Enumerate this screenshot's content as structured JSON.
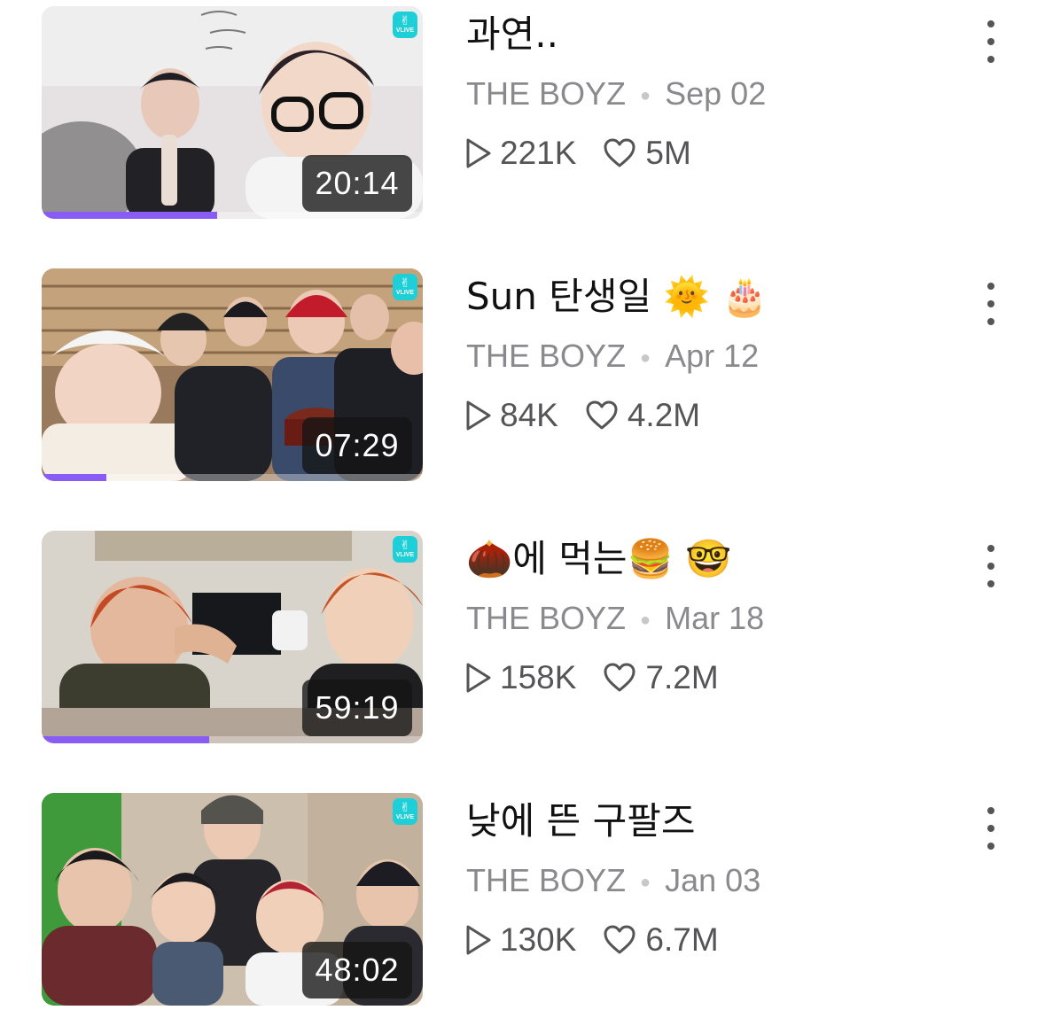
{
  "accent_color": "#8a5cf6",
  "videos": [
    {
      "title": "과연..",
      "channel": "THE BOYZ",
      "date": "Sep 02",
      "views": "221K",
      "likes": "5M",
      "duration": "20:14",
      "progress": 0.46,
      "badge": "VLIVE"
    },
    {
      "title": "Sun 탄생일 🌞 🎂",
      "channel": "THE BOYZ",
      "date": "Apr 12",
      "views": "84K",
      "likes": "4.2M",
      "duration": "07:29",
      "progress": 0.17,
      "badge": "VLIVE"
    },
    {
      "title": "🌰에 먹는🍔 🤓",
      "channel": "THE BOYZ",
      "date": "Mar 18",
      "views": "158K",
      "likes": "7.2M",
      "duration": "59:19",
      "progress": 0.44,
      "badge": "VLIVE"
    },
    {
      "title": "낮에 뜬 구팔즈",
      "channel": "THE BOYZ",
      "date": "Jan 03",
      "views": "130K",
      "likes": "6.7M",
      "duration": "48:02",
      "progress": 0,
      "badge": "VLIVE"
    }
  ]
}
